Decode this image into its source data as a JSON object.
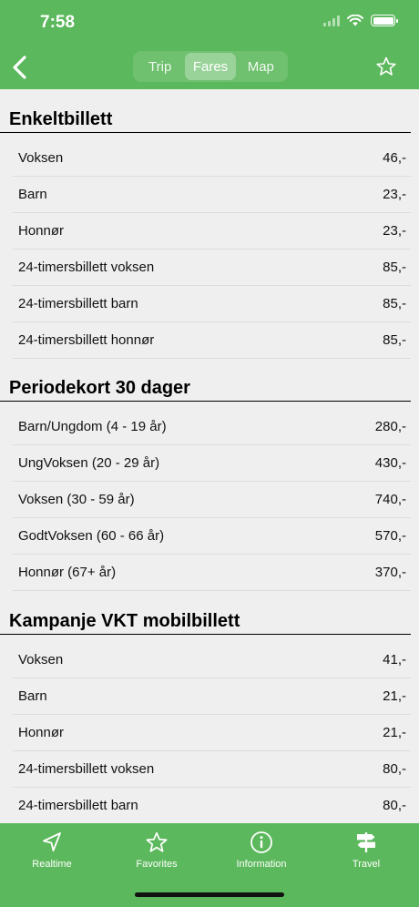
{
  "status": {
    "time": "7:58"
  },
  "nav": {
    "segments": [
      {
        "label": "Trip",
        "active": false
      },
      {
        "label": "Fares",
        "active": true
      },
      {
        "label": "Map",
        "active": false
      }
    ]
  },
  "sections": [
    {
      "title": "Enkeltbillett",
      "rows": [
        {
          "name": "Voksen",
          "price": "46,-"
        },
        {
          "name": "Barn",
          "price": "23,-"
        },
        {
          "name": "Honnør",
          "price": "23,-"
        },
        {
          "name": "24-timersbillett voksen",
          "price": "85,-"
        },
        {
          "name": "24-timersbillett barn",
          "price": "85,-"
        },
        {
          "name": "24-timersbillett honnør",
          "price": "85,-"
        }
      ]
    },
    {
      "title": "Periodekort 30 dager",
      "rows": [
        {
          "name": "Barn/Ungdom (4 - 19 år)",
          "price": "280,-"
        },
        {
          "name": "UngVoksen (20 - 29 år)",
          "price": "430,-"
        },
        {
          "name": "Voksen (30 - 59 år)",
          "price": "740,-"
        },
        {
          "name": "GodtVoksen (60 - 66 år)",
          "price": "570,-"
        },
        {
          "name": "Honnør (67+ år)",
          "price": "370,-"
        }
      ]
    },
    {
      "title": "Kampanje VKT mobilbillett",
      "rows": [
        {
          "name": "Voksen",
          "price": "41,-"
        },
        {
          "name": "Barn",
          "price": "21,-"
        },
        {
          "name": "Honnør",
          "price": "21,-"
        },
        {
          "name": "24-timersbillett voksen",
          "price": "80,-"
        },
        {
          "name": "24-timersbillett barn",
          "price": "80,-"
        }
      ]
    }
  ],
  "tabbar": {
    "tabs": [
      {
        "label": "Realtime",
        "icon": "navigation-arrow-icon"
      },
      {
        "label": "Favorites",
        "icon": "star-icon"
      },
      {
        "label": "Information",
        "icon": "info-icon"
      },
      {
        "label": "Travel",
        "icon": "signpost-icon"
      }
    ]
  },
  "colors": {
    "brand": "#5cb85c",
    "background": "#efefef"
  }
}
